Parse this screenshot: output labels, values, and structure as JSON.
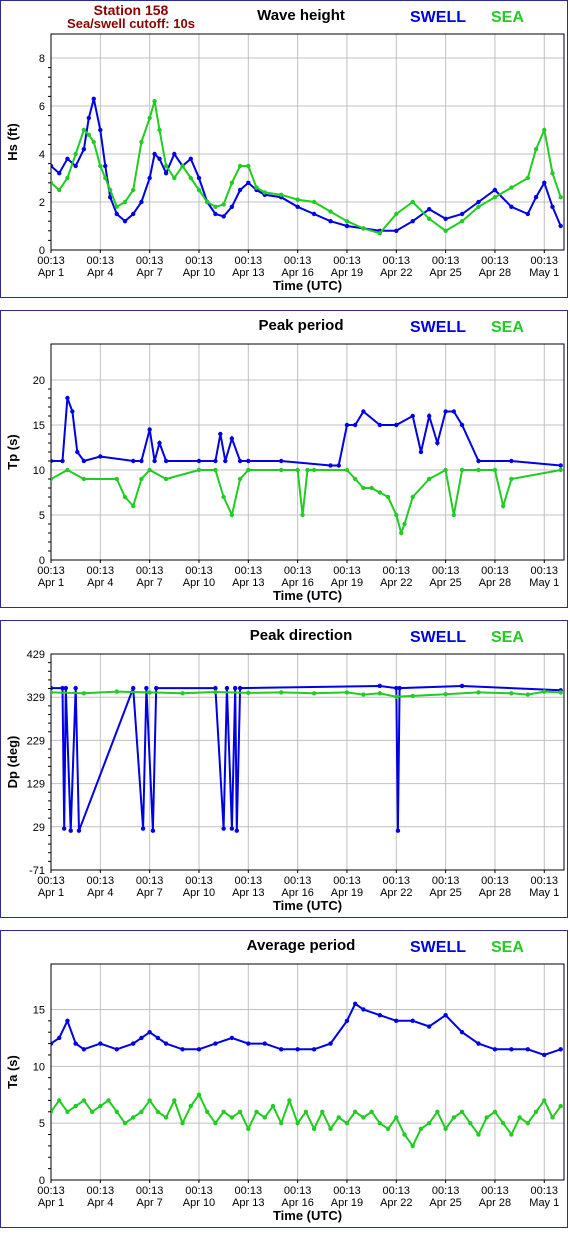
{
  "station": {
    "name": "Station 158",
    "cutoff": "Sea/swell cutoff: 10s"
  },
  "legend": {
    "swell": "SWELL",
    "sea": "SEA"
  },
  "colors": {
    "swell": "#0000e6",
    "sea": "#22cc22",
    "frame": "#2a2a9a",
    "grid": "#c0c0c0",
    "station_text": "#8b0000"
  },
  "x_axis": {
    "label": "Time (UTC)",
    "range_days": [
      0,
      31.2
    ],
    "ticks": [
      {
        "day": 0,
        "time": "00:13",
        "date": "Apr 1"
      },
      {
        "day": 3,
        "time": "00:13",
        "date": "Apr 4"
      },
      {
        "day": 6,
        "time": "00:13",
        "date": "Apr 7"
      },
      {
        "day": 9,
        "time": "00:13",
        "date": "Apr 10"
      },
      {
        "day": 12,
        "time": "00:13",
        "date": "Apr 13"
      },
      {
        "day": 15,
        "time": "00:13",
        "date": "Apr 16"
      },
      {
        "day": 18,
        "time": "00:13",
        "date": "Apr 19"
      },
      {
        "day": 21,
        "time": "00:13",
        "date": "Apr 22"
      },
      {
        "day": 24,
        "time": "00:13",
        "date": "Apr 25"
      },
      {
        "day": 27,
        "time": "00:13",
        "date": "Apr 28"
      },
      {
        "day": 30,
        "time": "00:13",
        "date": "May 1"
      }
    ]
  },
  "chart_data": [
    {
      "id": "wave-height",
      "type": "line",
      "title": "Wave height",
      "ylabel": "Hs (ft)",
      "ylim": [
        0,
        9
      ],
      "yticks": [
        0,
        2,
        4,
        6,
        8
      ],
      "grid": true,
      "legend_position": "top-right",
      "series": [
        {
          "name": "SWELL",
          "color": "#0000e6",
          "x": [
            0,
            0.5,
            1,
            1.5,
            2,
            2.3,
            2.6,
            3,
            3.3,
            3.6,
            4,
            4.5,
            5,
            5.5,
            6,
            6.3,
            6.6,
            7,
            7.5,
            8,
            8.5,
            9,
            9.5,
            10,
            10.5,
            11,
            11.5,
            12,
            12.5,
            13,
            14,
            15,
            16,
            17,
            18,
            19,
            20,
            21,
            22,
            23,
            24,
            25,
            26,
            27,
            28,
            29,
            29.5,
            30,
            30.5,
            31
          ],
          "values": [
            3.5,
            3.2,
            3.8,
            3.5,
            4.2,
            5.5,
            6.3,
            5.0,
            3.5,
            2.2,
            1.5,
            1.2,
            1.5,
            2.0,
            3.0,
            4.0,
            3.8,
            3.2,
            4.0,
            3.5,
            3.8,
            3.0,
            2.0,
            1.5,
            1.4,
            1.8,
            2.5,
            2.8,
            2.5,
            2.3,
            2.2,
            1.8,
            1.5,
            1.2,
            1.0,
            0.9,
            0.8,
            0.8,
            1.2,
            1.7,
            1.3,
            1.5,
            2.0,
            2.5,
            1.8,
            1.5,
            2.2,
            2.8,
            1.8,
            1.0
          ]
        },
        {
          "name": "SEA",
          "color": "#22cc22",
          "x": [
            0,
            0.5,
            1,
            1.5,
            2,
            2.3,
            2.6,
            3,
            3.3,
            3.6,
            4,
            4.5,
            5,
            5.5,
            6,
            6.3,
            6.6,
            7,
            7.5,
            8,
            8.5,
            9,
            9.5,
            10,
            10.5,
            11,
            11.5,
            12,
            12.5,
            13,
            14,
            15,
            16,
            17,
            18,
            19,
            20,
            21,
            22,
            23,
            24,
            25,
            26,
            27,
            28,
            29,
            29.5,
            30,
            30.5,
            31
          ],
          "values": [
            2.8,
            2.5,
            3.0,
            4.0,
            5.0,
            4.8,
            4.5,
            3.5,
            3.0,
            2.5,
            1.8,
            2.0,
            2.5,
            4.5,
            5.5,
            6.2,
            5.0,
            3.5,
            3.0,
            3.5,
            3.0,
            2.5,
            2.0,
            1.8,
            1.9,
            2.8,
            3.5,
            3.5,
            2.6,
            2.4,
            2.3,
            2.1,
            2.0,
            1.6,
            1.2,
            0.9,
            0.7,
            1.5,
            2.0,
            1.3,
            0.8,
            1.2,
            1.8,
            2.2,
            2.6,
            3.0,
            4.2,
            5.0,
            3.2,
            2.2
          ]
        }
      ]
    },
    {
      "id": "peak-period",
      "type": "line",
      "title": "Peak period",
      "ylabel": "Tp (s)",
      "ylim": [
        0,
        24
      ],
      "yticks": [
        0,
        5,
        10,
        15,
        20
      ],
      "grid": true,
      "legend_position": "top-right",
      "series": [
        {
          "name": "SWELL",
          "color": "#0000e6",
          "x": [
            0,
            0.7,
            1,
            1.3,
            1.6,
            2,
            3,
            5,
            5.5,
            6,
            6.3,
            6.6,
            7,
            9,
            10,
            10.3,
            10.6,
            11,
            11.5,
            12,
            14,
            17,
            17.5,
            18,
            18.5,
            19,
            20,
            21,
            22,
            22.5,
            23,
            23.5,
            24,
            24.5,
            25,
            26,
            28,
            31
          ],
          "values": [
            11,
            11,
            18,
            16.5,
            12,
            11,
            11.5,
            11,
            11,
            14.5,
            11,
            13,
            11,
            11,
            11,
            14,
            11,
            13.5,
            11,
            11,
            11,
            10.5,
            10.5,
            15,
            15,
            16.5,
            15,
            15,
            16,
            12,
            16,
            13,
            16.5,
            16.5,
            15,
            11,
            11,
            10.5
          ]
        },
        {
          "name": "SEA",
          "color": "#22cc22",
          "x": [
            0,
            1,
            2,
            4,
            4.5,
            5,
            5.5,
            6,
            7,
            9,
            10,
            10.5,
            11,
            11.5,
            12,
            14,
            15,
            15.3,
            15.6,
            16,
            18,
            18.5,
            19,
            19.5,
            20,
            20.5,
            21,
            21.3,
            21.5,
            22,
            23,
            24,
            24.5,
            25,
            26,
            27,
            27.5,
            28,
            31
          ],
          "values": [
            9,
            10,
            9,
            9,
            7,
            6,
            9,
            10,
            9,
            10,
            10,
            7,
            5,
            9,
            10,
            10,
            10,
            5,
            10,
            10,
            10,
            9,
            8,
            8,
            7.5,
            7,
            5,
            3,
            4,
            7,
            9,
            10,
            5,
            10,
            10,
            10,
            6,
            9,
            10
          ]
        }
      ]
    },
    {
      "id": "peak-direction",
      "type": "line",
      "title": "Peak direction",
      "ylabel": "Dp (deg)",
      "ylim": [
        -71,
        429
      ],
      "yticks": [
        -71,
        29,
        129,
        229,
        329,
        429
      ],
      "grid": true,
      "legend_position": "top-right",
      "series": [
        {
          "name": "SWELL",
          "color": "#0000e6",
          "x": [
            0,
            0.7,
            0.8,
            0.9,
            1.2,
            1.5,
            1.7,
            5,
            5.6,
            5.8,
            6.2,
            6.4,
            10,
            10.5,
            10.7,
            11,
            11.2,
            11.3,
            11.5,
            20,
            21,
            21.1,
            21.2,
            25,
            31
          ],
          "values": [
            350,
            350,
            25,
            350,
            20,
            350,
            20,
            350,
            25,
            350,
            20,
            350,
            350,
            25,
            350,
            25,
            350,
            20,
            350,
            355,
            350,
            20,
            350,
            355,
            345
          ]
        },
        {
          "name": "SEA",
          "color": "#22cc22",
          "x": [
            0,
            2,
            4,
            6,
            8,
            10,
            12,
            14,
            16,
            18,
            19,
            20,
            21,
            22,
            24,
            26,
            28,
            29,
            30,
            31
          ],
          "values": [
            340,
            338,
            342,
            340,
            338,
            341,
            339,
            340,
            338,
            340,
            335,
            338,
            330,
            332,
            336,
            340,
            338,
            335,
            342,
            340
          ]
        }
      ]
    },
    {
      "id": "average-period",
      "type": "line",
      "title": "Average period",
      "ylabel": "Ta (s)",
      "ylim": [
        0,
        19
      ],
      "yticks": [
        0,
        5,
        10,
        15
      ],
      "grid": true,
      "legend_position": "top-right",
      "series": [
        {
          "name": "SWELL",
          "color": "#0000e6",
          "x": [
            0,
            0.5,
            1,
            1.5,
            2,
            3,
            4,
            5,
            5.5,
            6,
            6.5,
            7,
            8,
            9,
            10,
            11,
            12,
            13,
            14,
            15,
            16,
            17,
            18,
            18.5,
            19,
            20,
            21,
            22,
            23,
            24,
            25,
            26,
            27,
            28,
            29,
            30,
            31
          ],
          "values": [
            12,
            12.5,
            14,
            12,
            11.5,
            12,
            11.5,
            12,
            12.5,
            13,
            12.5,
            12,
            11.5,
            11.5,
            12,
            12.5,
            12,
            12,
            11.5,
            11.5,
            11.5,
            12,
            14,
            15.5,
            15,
            14.5,
            14,
            14,
            13.5,
            14.5,
            13,
            12,
            11.5,
            11.5,
            11.5,
            11,
            11.5
          ]
        },
        {
          "name": "SEA",
          "color": "#22cc22",
          "x": [
            0,
            0.5,
            1,
            1.5,
            2,
            2.5,
            3,
            3.5,
            4,
            4.5,
            5,
            5.5,
            6,
            6.5,
            7,
            7.5,
            8,
            8.5,
            9,
            9.5,
            10,
            10.5,
            11,
            11.5,
            12,
            12.5,
            13,
            13.5,
            14,
            14.5,
            15,
            15.5,
            16,
            16.5,
            17,
            17.5,
            18,
            18.5,
            19,
            19.5,
            20,
            20.5,
            21,
            21.5,
            22,
            22.5,
            23,
            23.5,
            24,
            24.5,
            25,
            25.5,
            26,
            26.5,
            27,
            27.5,
            28,
            28.5,
            29,
            29.5,
            30,
            30.5,
            31
          ],
          "values": [
            6,
            7,
            6,
            6.5,
            7,
            6,
            6.5,
            7,
            6,
            5,
            5.5,
            6,
            7,
            6,
            5.5,
            7,
            5,
            6.5,
            7.5,
            6,
            5,
            6,
            5.5,
            6,
            4.5,
            6,
            5.5,
            6.5,
            5,
            7,
            5,
            6,
            4.5,
            6,
            4.5,
            5.5,
            5,
            6,
            5.5,
            6,
            5,
            4.5,
            5.5,
            4,
            3,
            4.5,
            5,
            6,
            4.5,
            5.5,
            6,
            5,
            4,
            5.5,
            6,
            5,
            4,
            5.5,
            5,
            6,
            7,
            5.5,
            6.5
          ]
        }
      ]
    }
  ]
}
